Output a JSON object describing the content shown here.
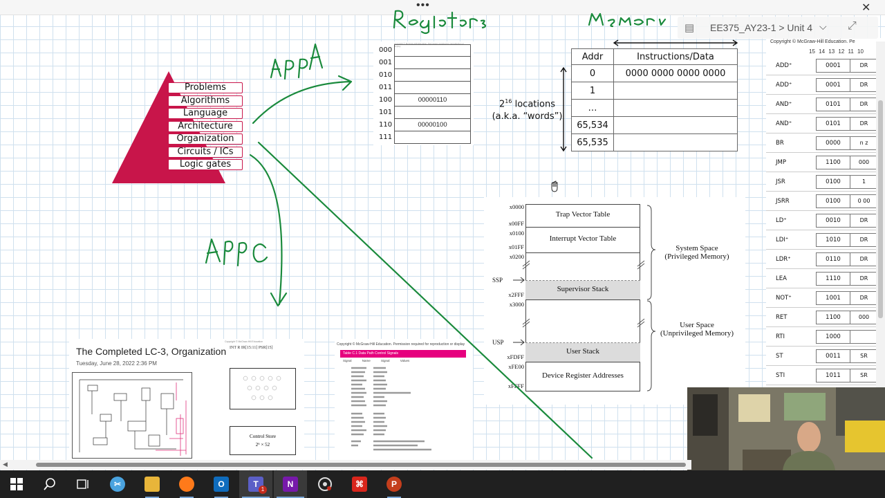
{
  "top_bar": {
    "dots": "•••",
    "close": "✕"
  },
  "breadcrumb": {
    "text": "EE375_AY23-1 > Unit 4",
    "icon": "section-icon",
    "chevron": "chevron-down-icon",
    "expand": "expand-icon"
  },
  "handwriting": {
    "registers": "Registers",
    "memory": "Memory",
    "app_a": "App A",
    "app_c": "App C"
  },
  "pyramid": {
    "layers": [
      "Problems",
      "Algorithms",
      "Language",
      "Architecture",
      "Organization",
      "Circuits / ICs",
      "Logic gates"
    ],
    "color": "#c8154a"
  },
  "registers": {
    "note": "Copyright © McGraw-Hill Education. Permission required for reproduction or display.",
    "rows": [
      {
        "addr": "000",
        "value": ""
      },
      {
        "addr": "001",
        "value": ""
      },
      {
        "addr": "010",
        "value": ""
      },
      {
        "addr": "011",
        "value": ""
      },
      {
        "addr": "100",
        "value": "00000110"
      },
      {
        "addr": "101",
        "value": ""
      },
      {
        "addr": "110",
        "value": "00000100"
      },
      {
        "addr": "111",
        "value": ""
      }
    ]
  },
  "memory_table": {
    "headers": [
      "Addr",
      "Instructions/Data"
    ],
    "rows": [
      {
        "addr": "0",
        "data": "0000 0000 0000 0000"
      },
      {
        "addr": "1",
        "data": ""
      },
      {
        "addr": "…",
        "data": ""
      },
      {
        "addr": "65,534",
        "data": ""
      },
      {
        "addr": "65,535",
        "data": ""
      }
    ],
    "locations_base": "2",
    "locations_exp": "16",
    "locations_rest": " locations",
    "words_note": "(a.k.a. “words”)"
  },
  "memory_map": {
    "addresses": [
      "x0000",
      "x00FF",
      "x0100",
      "x01FF",
      "x0200",
      "x2FFF",
      "x3000",
      "xFDFF",
      "xFE00",
      "xFFFF"
    ],
    "blocks": {
      "trap": "Trap Vector Table",
      "interrupt": "Interrupt Vector Table",
      "supervisor": "Supervisor Stack",
      "user": "User Stack",
      "device": "Device Register Addresses"
    },
    "pointers": {
      "ssp": "SSP",
      "usp": "USP"
    },
    "system_space": "System Space",
    "system_space_sub": "(Privileged Memory)",
    "user_space": "User Space",
    "user_space_sub": "(Unprivileged Memory)"
  },
  "isa": {
    "copyright": "Copyright © McGraw-Hill Education. Pe",
    "bits": "15 14 13 12 11 10",
    "rows": [
      {
        "name": "ADD⁺",
        "opcode": "0001",
        "rest": "DR"
      },
      {
        "name": "ADD⁺",
        "opcode": "0001",
        "rest": "DR"
      },
      {
        "name": "AND⁺",
        "opcode": "0101",
        "rest": "DR"
      },
      {
        "name": "AND⁺",
        "opcode": "0101",
        "rest": "DR"
      },
      {
        "name": "BR",
        "opcode": "0000",
        "rest": "n z"
      },
      {
        "name": "JMP",
        "opcode": "1100",
        "rest": "000"
      },
      {
        "name": "JSR",
        "opcode": "0100",
        "rest": "1"
      },
      {
        "name": "JSRR",
        "opcode": "0100",
        "rest": "0 00"
      },
      {
        "name": "LD⁺",
        "opcode": "0010",
        "rest": "DR"
      },
      {
        "name": "LDI⁺",
        "opcode": "1010",
        "rest": "DR"
      },
      {
        "name": "LDR⁺",
        "opcode": "0110",
        "rest": "DR"
      },
      {
        "name": "LEA",
        "opcode": "1110",
        "rest": "DR"
      },
      {
        "name": "NOT⁺",
        "opcode": "1001",
        "rest": "DR"
      },
      {
        "name": "RET",
        "opcode": "1100",
        "rest": "000"
      },
      {
        "name": "RTI",
        "opcode": "1000",
        "rest": ""
      },
      {
        "name": "ST",
        "opcode": "0011",
        "rest": "SR"
      },
      {
        "name": "STI",
        "opcode": "1011",
        "rest": "SR"
      }
    ]
  },
  "slide_thumb": {
    "title": "The Completed LC-3, Organization",
    "date": "Tuesday, June 28, 2022     2:36 PM",
    "signals": "INT  R    IR[15:11]  PSR[15]",
    "store_label": "Control Store",
    "store_size": "2⁶ × 52"
  },
  "table_thumb": {
    "copyright": "Copyright © McGraw-Hill Education. Permission required for reproduction or display",
    "header": "Table C.1     Data Path Control Signals",
    "cols": "Signal Name  Signal Values"
  },
  "taskbar": {
    "items": [
      {
        "name": "windows-start-button",
        "icon": "windows-icon",
        "label": "",
        "color": ""
      },
      {
        "name": "search-button",
        "icon": "search-icon",
        "label": "",
        "color": ""
      },
      {
        "name": "task-view-button",
        "icon": "task-view-icon",
        "label": "",
        "color": ""
      },
      {
        "name": "snipping-tool-button",
        "icon": "snipping-tool-icon",
        "label": "",
        "color": "#4aa3df"
      },
      {
        "name": "file-explorer-button",
        "icon": "folder-icon",
        "label": "",
        "color": "#e8b53a"
      },
      {
        "name": "firefox-button",
        "icon": "firefox-icon",
        "label": "",
        "color": "#ff7a1a"
      },
      {
        "name": "outlook-button",
        "icon": "outlook-icon",
        "label": "O",
        "color": "#0f6cbd"
      },
      {
        "name": "teams-button",
        "icon": "teams-icon",
        "label": "T",
        "color": "#5b5fc7"
      },
      {
        "name": "onenote-button",
        "icon": "onenote-icon",
        "label": "N",
        "color": "#7719aa"
      },
      {
        "name": "snagit-button",
        "icon": "capture-icon",
        "label": "",
        "color": "#3a3a3a"
      },
      {
        "name": "acrobat-button",
        "icon": "acrobat-icon",
        "label": "",
        "color": "#d9261c"
      },
      {
        "name": "powerpoint-button",
        "icon": "powerpoint-icon",
        "label": "P",
        "color": "#c43e1c"
      }
    ],
    "teams_badge": "1"
  },
  "colors": {
    "ink": "#1a8a3c",
    "accent": "#c8154a",
    "taskbar": "#202020",
    "table_header": "#e6007e"
  }
}
